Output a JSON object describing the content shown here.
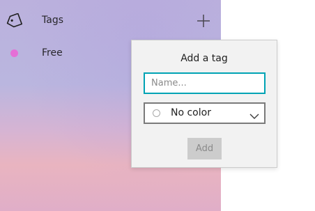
{
  "sidebar": {
    "tags_label": "Tags",
    "tag_icon": "tag-icon",
    "add_icon": "plus-icon",
    "items": [
      {
        "label": "Free",
        "color": "#e56fd6"
      }
    ]
  },
  "popup": {
    "title": "Add a tag",
    "name_input": {
      "placeholder": "Name...",
      "value": ""
    },
    "color_select": {
      "selected": "No color",
      "options": [
        "No color"
      ]
    },
    "add_button_label": "Add",
    "add_button_enabled": false
  },
  "colors": {
    "accent": "#00a3b4",
    "free_tag": "#e56fd6"
  }
}
